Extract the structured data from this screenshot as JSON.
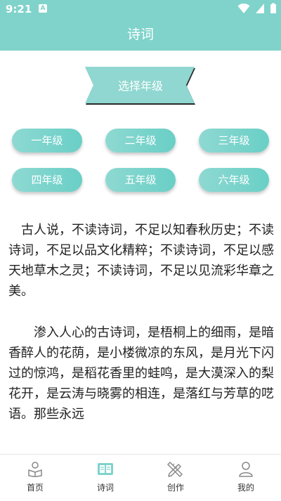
{
  "status_bar": {
    "time": "9:21",
    "notification_glyph": "A"
  },
  "header": {
    "title": "诗词"
  },
  "grade_selector": {
    "title": "选择年级",
    "grades": [
      "一年级",
      "二年级",
      "三年级",
      "四年级",
      "五年级",
      "六年级"
    ]
  },
  "intro": {
    "paragraph_1": "古人说，不读诗词，不足以知春秋历史；不读诗词，不足以品文化精粹；不读诗词，不足以感天地草木之灵；不读诗词，不足以见流彩华章之美。",
    "paragraph_2": "渗入人心的古诗词，是梧桐上的细雨，是暗香醉人的花荫，是小楼微凉的东风，是月光下闪过的惊鸿，是稻花香里的蛙鸣，是大漠深入的梨花开，是云涛与晓雾的相连，是落红与芳草的呓语。那些永远"
  },
  "bottom_nav": {
    "items": [
      {
        "label": "首页",
        "icon": "home-reader-icon"
      },
      {
        "label": "诗词",
        "icon": "book-icon"
      },
      {
        "label": "创作",
        "icon": "pencil-ruler-icon"
      },
      {
        "label": "我的",
        "icon": "user-icon"
      }
    ],
    "active_index": 1
  },
  "colors": {
    "primary": "#7fd3cb",
    "active_icon": "#7fd3cb",
    "inactive_icon": "#888888"
  }
}
